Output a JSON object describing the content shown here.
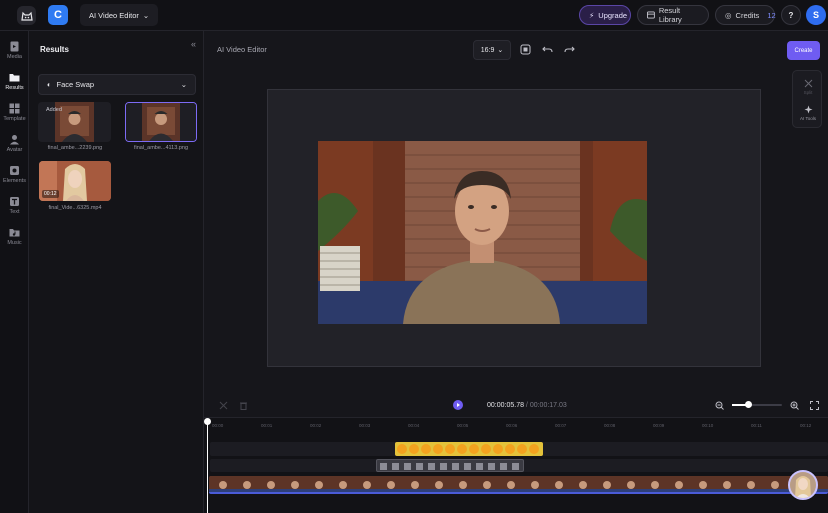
{
  "header": {
    "app_title": "AI Video Editor",
    "logo_letter": "C",
    "upgrade_label": "Upgrade",
    "library_label": "Result Library",
    "credits_label": "Credits",
    "credits_value": "12",
    "help_label": "?",
    "user_initial": "S"
  },
  "rail": {
    "items": [
      {
        "label": "Media",
        "icon": "media-icon"
      },
      {
        "label": "Results",
        "icon": "folder-icon"
      },
      {
        "label": "Template",
        "icon": "template-icon"
      },
      {
        "label": "Avatar",
        "icon": "avatar-icon"
      },
      {
        "label": "Elements",
        "icon": "elements-icon"
      },
      {
        "label": "Text",
        "icon": "text-icon"
      },
      {
        "label": "Music",
        "icon": "music-icon"
      }
    ]
  },
  "results": {
    "title": "Results",
    "filter": "Face Swap",
    "items": [
      {
        "caption": "final_ambe...2239.png",
        "tag": "Added"
      },
      {
        "caption": "final_ambe...4113.png"
      },
      {
        "caption": "final_Vide...6325.mp4",
        "duration": "00:12"
      }
    ]
  },
  "editor": {
    "title": "AI Video Editor",
    "aspect_ratio": "16:9",
    "create_label": "Create",
    "side_tools": [
      "Split",
      "AI Tools"
    ]
  },
  "playback": {
    "current": "00:00:05.78",
    "separator": " / ",
    "total": "00:00:17.03"
  },
  "timeline": {
    "ticks": [
      "00:00",
      "00:01",
      "00:02",
      "00:03",
      "00:04",
      "00:05",
      "00:06",
      "00:07",
      "00:08",
      "00:09",
      "00:10",
      "00:11",
      "00:12"
    ]
  },
  "colors": {
    "accent": "#6f5cf2",
    "brand_blue": "#2f7bf2"
  }
}
